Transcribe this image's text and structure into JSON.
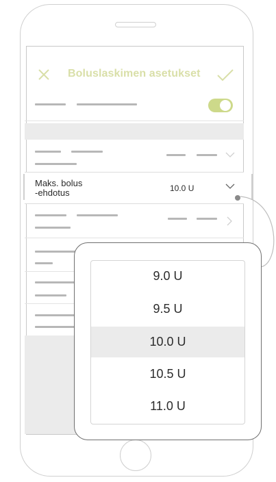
{
  "header": {
    "title": "Boluslaskimen asetukset",
    "close_icon": "close-x-icon",
    "confirm_icon": "checkmark-icon",
    "accent_color": "#d9dfa8"
  },
  "settings_row": {
    "label": "Maks. bolus\n-ehdotus",
    "label_line1": "Maks. bolus",
    "label_line2": "-ehdotus",
    "value": "10.0 U",
    "icon": "chevron-down-icon"
  },
  "toggle": {
    "state": "on",
    "color": "#cdd98a"
  },
  "picker": {
    "options": [
      "9.0 U",
      "9.5 U",
      "10.0 U",
      "10.5 U",
      "11.0 U"
    ],
    "selected": "10.0 U"
  }
}
